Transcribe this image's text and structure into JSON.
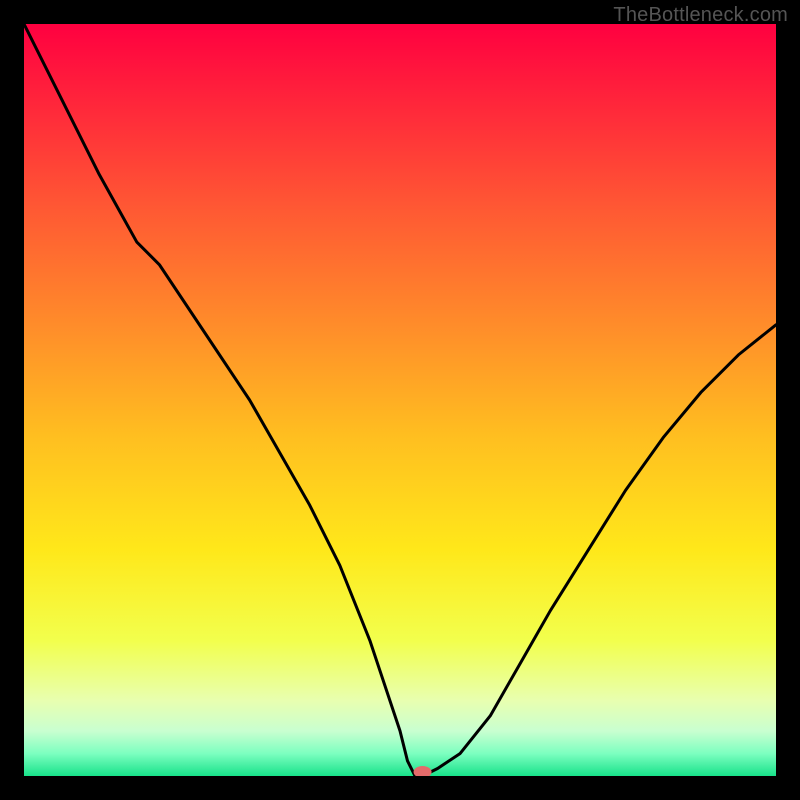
{
  "watermark": "TheBottleneck.com",
  "chart_data": {
    "type": "line",
    "title": "",
    "xlabel": "",
    "ylabel": "",
    "xlim": [
      0,
      100
    ],
    "ylim": [
      0,
      100
    ],
    "background": {
      "type": "vertical-gradient",
      "stops": [
        {
          "pos": 0.0,
          "color": "#ff0040"
        },
        {
          "pos": 0.12,
          "color": "#ff2b3a"
        },
        {
          "pos": 0.25,
          "color": "#ff5a33"
        },
        {
          "pos": 0.4,
          "color": "#ff8c2a"
        },
        {
          "pos": 0.55,
          "color": "#ffbf20"
        },
        {
          "pos": 0.7,
          "color": "#ffe81a"
        },
        {
          "pos": 0.82,
          "color": "#f2ff4d"
        },
        {
          "pos": 0.9,
          "color": "#e8ffb0"
        },
        {
          "pos": 0.94,
          "color": "#c9ffd0"
        },
        {
          "pos": 0.97,
          "color": "#7dffc0"
        },
        {
          "pos": 1.0,
          "color": "#18e28a"
        }
      ]
    },
    "series": [
      {
        "name": "bottleneck-curve",
        "color": "#000000",
        "stroke_width": 3,
        "x": [
          0,
          5,
          10,
          15,
          18,
          22,
          26,
          30,
          34,
          38,
          42,
          46,
          48,
          50,
          51,
          52,
          53,
          55,
          58,
          62,
          66,
          70,
          75,
          80,
          85,
          90,
          95,
          100
        ],
        "values": [
          100,
          90,
          80,
          71,
          68,
          62,
          56,
          50,
          43,
          36,
          28,
          18,
          12,
          6,
          2,
          0,
          0,
          1,
          3,
          8,
          15,
          22,
          30,
          38,
          45,
          51,
          56,
          60
        ]
      }
    ],
    "marker": {
      "name": "optimal-point",
      "x": 53,
      "y": 0,
      "color": "#e46a6a",
      "rx": 9,
      "ry": 6
    }
  }
}
